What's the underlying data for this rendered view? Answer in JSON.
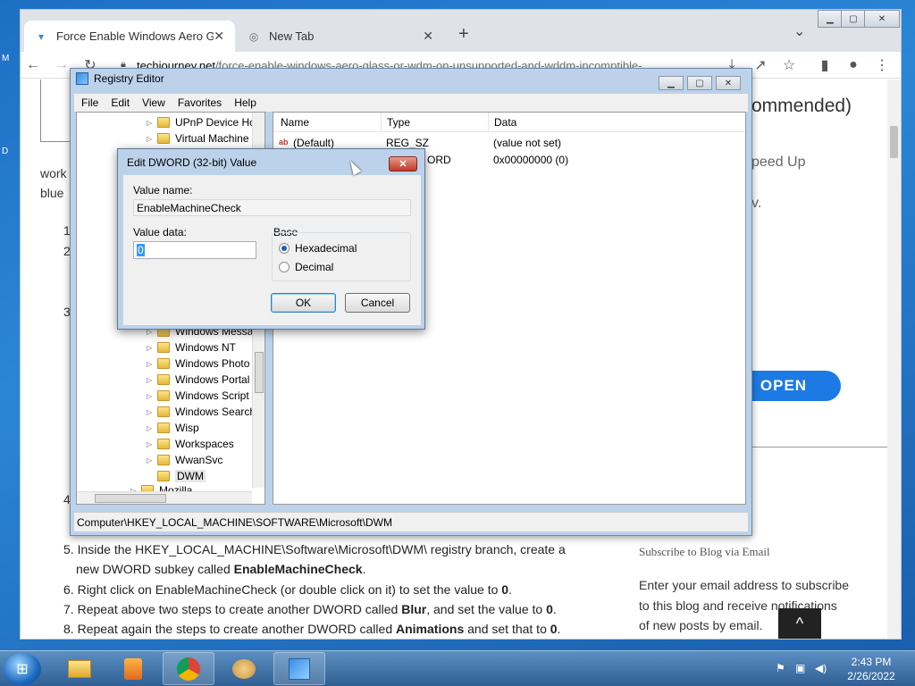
{
  "desktop": {
    "left_glyph_1": "M",
    "left_glyph_2": "D"
  },
  "chrome": {
    "tabs": [
      {
        "title": "Force Enable Windows Aero Glas",
        "icon": "shield-favicon"
      },
      {
        "title": "New Tab",
        "icon": "chrome-favicon"
      }
    ],
    "new_tab": "+",
    "tab_menu": "⌄",
    "url_domain": "techjourney.net",
    "url_path": "/force-enable-windows-aero-glass-or-wdm-on-unsupported-and-wddm-incomptible-...",
    "window_buttons": {
      "min": "▁",
      "max": "▢",
      "close": "✕"
    }
  },
  "web": {
    "left_fragment_1": "work",
    "left_fragment_2": "blue",
    "num_1": "1",
    "num_2": "2",
    "num_3": "3",
    "num_4": "4",
    "right_heading": "ommended)",
    "right_line_1": "peed Up",
    "right_line_2": "v.",
    "open_button": "OPEN",
    "steps": [
      {
        "num": "5.",
        "text": "Inside the HKEY_LOCAL_MACHINE\\Software\\Microsoft\\DWM\\ registry branch, create a"
      },
      {
        "num": "",
        "text_pre": "new DWORD subkey called ",
        "bold": "EnableMachineCheck",
        "text_post": "."
      },
      {
        "num": "6.",
        "text_pre": "Right click on EnableMachineCheck (or double click on it) to set the value to ",
        "bold": "0",
        "text_post": "."
      },
      {
        "num": "7.",
        "text_pre": "Repeat above two steps to create another DWORD called ",
        "bold": "Blur",
        "text_post": ", and set the value to ",
        "bold2": "0",
        "text_post2": "."
      },
      {
        "num": "8.",
        "text_pre": "Repeat again the steps to create another DWORD called ",
        "bold": "Animations",
        "text_post": " and set that to ",
        "bold2": "0",
        "text_post2": "."
      }
    ],
    "subscribe_title": "Subscribe to Blog via Email",
    "subscribe_text": [
      "Enter your email address to subscribe",
      "to this blog and receive notifications",
      "of new posts by email."
    ],
    "back_to_top": "^"
  },
  "regedit": {
    "title": "Registry Editor",
    "menu": [
      "File",
      "Edit",
      "View",
      "Favorites",
      "Help"
    ],
    "tree_top": [
      "UPnP Device Hc",
      "Virtual Machine"
    ],
    "tree_bottom": [
      "Windows Messa",
      "Windows NT",
      "Windows Photo",
      "Windows Portal",
      "Windows Script",
      "Windows Search",
      "Wisp",
      "Workspaces",
      "WwanSvc",
      "DWM",
      "Mozilla"
    ],
    "columns": [
      "Name",
      "Type",
      "Data"
    ],
    "rows": [
      {
        "name": "(Default)",
        "type": "REG_SZ",
        "data": "(value not set)"
      },
      {
        "name": "",
        "type": "ORD",
        "data": "0x00000000 (0)"
      }
    ],
    "status": "Computer\\HKEY_LOCAL_MACHINE\\SOFTWARE\\Microsoft\\DWM"
  },
  "dialog": {
    "title": "Edit DWORD (32-bit) Value",
    "close": "✕",
    "value_name_label": "Value name:",
    "value_name": "EnableMachineCheck",
    "value_data_label": "Value data:",
    "value_data": "0",
    "base_label": "Base",
    "hex_label": "Hexadecimal",
    "dec_label": "Decimal",
    "ok": "OK",
    "cancel": "Cancel"
  },
  "taskbar": {
    "time": "2:43 PM",
    "date": "2/26/2022"
  }
}
